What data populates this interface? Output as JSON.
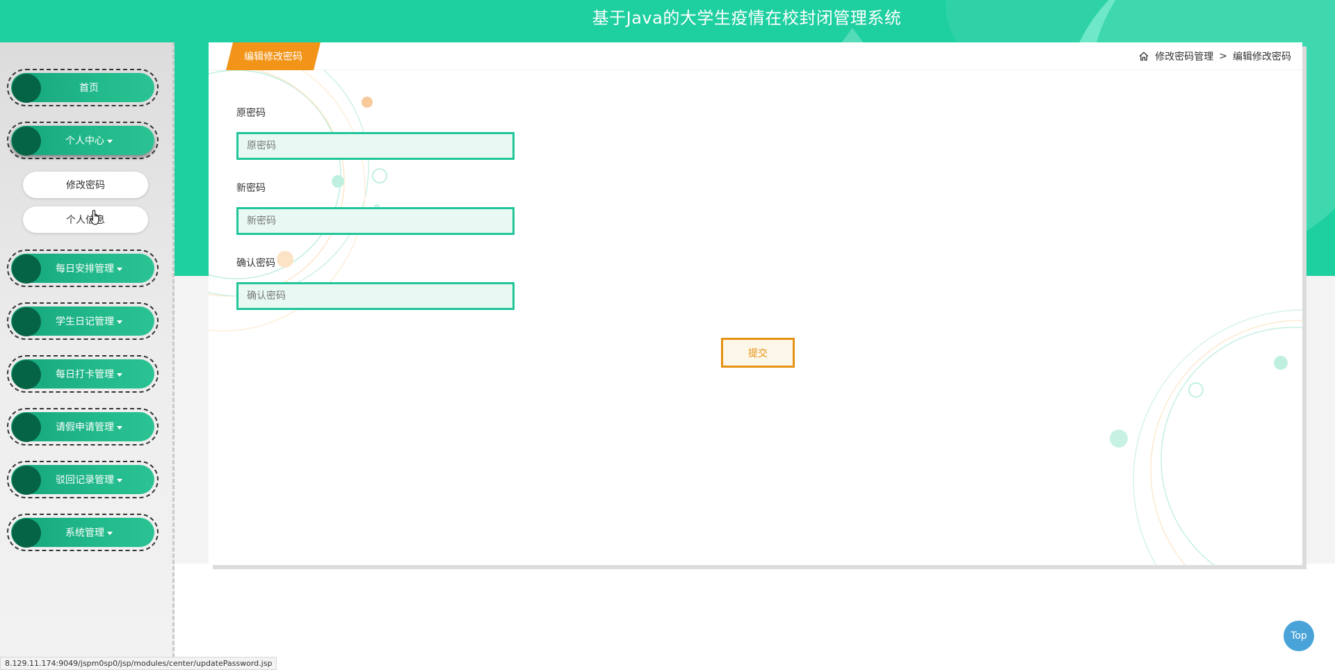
{
  "header": {
    "title": "基于Java的大学生疫情在校封闭管理系统",
    "fullscreen_icon": "fullscreen-icon",
    "user_icon": "user-icon"
  },
  "sidebar": {
    "items": [
      {
        "label": "首页",
        "dropdown": false
      },
      {
        "label": "个人中心",
        "dropdown": true,
        "active": true,
        "sub_items": [
          "修改密码",
          "个人信息"
        ]
      },
      {
        "label": "每日安排管理",
        "dropdown": true
      },
      {
        "label": "学生日记管理",
        "dropdown": true
      },
      {
        "label": "每日打卡管理",
        "dropdown": true
      },
      {
        "label": "请假申请管理",
        "dropdown": true
      },
      {
        "label": "驳回记录管理",
        "dropdown": true
      },
      {
        "label": "系统管理",
        "dropdown": true
      }
    ]
  },
  "card": {
    "tab_label": "编辑修改密码",
    "breadcrumb": {
      "home_icon": "home-icon",
      "parent": "修改密码管理",
      "separator": ">",
      "current": "编辑修改密码"
    }
  },
  "form": {
    "old_password": {
      "label": "原密码",
      "placeholder": "原密码",
      "value": ""
    },
    "new_password": {
      "label": "新密码",
      "placeholder": "新密码",
      "value": ""
    },
    "confirm_password": {
      "label": "确认密码",
      "placeholder": "确认密码",
      "value": ""
    },
    "submit_label": "提交"
  },
  "top_button": "Top",
  "status_url": "8.129.11.174:9049/jspm0sp0/jsp/modules/center/updatePassword.jsp",
  "colors": {
    "primary": "#1ecfa0",
    "menu_pill": "#22b98b",
    "menu_dot": "#066446",
    "accent_orange": "#f29418",
    "input_border": "#20c59a",
    "top_button": "#4aa3d8"
  }
}
